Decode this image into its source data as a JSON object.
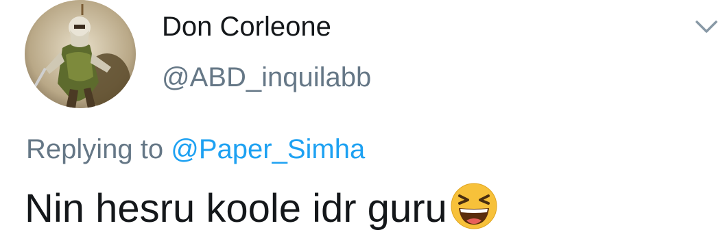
{
  "author": {
    "display_name": "Don Corleone",
    "handle": "@ABD_inquilabb",
    "avatar": "warrior-avatar"
  },
  "reply": {
    "prefix": "Replying to ",
    "mention": "@Paper_Simha"
  },
  "tweet": {
    "text": "Nin hesru koole idr guru",
    "emoji": "grinning-squinting-face-emoji"
  },
  "icons": {
    "menu": "chevron-down-icon"
  },
  "colors": {
    "name": "#14171a",
    "secondary": "#657786",
    "link": "#1da1f2",
    "emoji": "#f7c13a"
  }
}
